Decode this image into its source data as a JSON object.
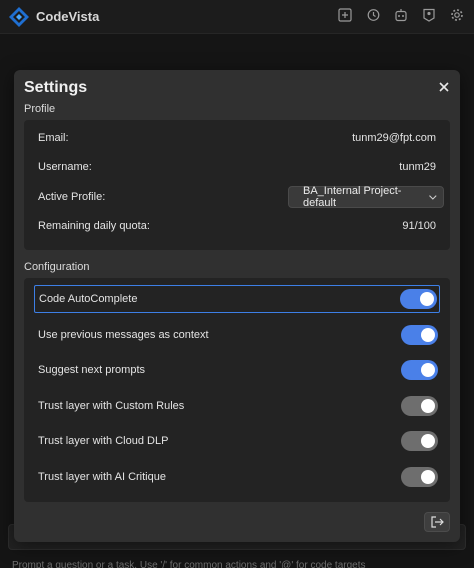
{
  "app": {
    "name": "CodeVista"
  },
  "topbar_icons": [
    "add-panel-icon",
    "history-icon",
    "agent-icon",
    "profile-badge-icon",
    "gear-icon"
  ],
  "modal": {
    "title": "Settings",
    "profile": {
      "section_label": "Profile",
      "email_label": "Email:",
      "email_value": "tunm29@fpt.com",
      "username_label": "Username:",
      "username_value": "tunm29",
      "active_profile_label": "Active Profile:",
      "active_profile_value": "BA_Internal Project-default",
      "quota_label": "Remaining daily quota:",
      "quota_value": "91/100"
    },
    "configuration": {
      "section_label": "Configuration",
      "items": [
        {
          "label": "Code AutoComplete",
          "enabled": true
        },
        {
          "label": "Use previous messages as context",
          "enabled": true
        },
        {
          "label": "Suggest next prompts",
          "enabled": true
        },
        {
          "label": "Trust layer with Custom Rules",
          "enabled": false
        },
        {
          "label": "Trust layer with Cloud DLP",
          "enabled": false
        },
        {
          "label": "Trust layer with AI Critique",
          "enabled": false
        }
      ]
    }
  },
  "composer": {
    "hint": "Prompt a question or a task. Use '/' for common actions and '@' for code targets"
  },
  "colors": {
    "accent": "#4a80e8",
    "toggle_off": "#6e6e6e",
    "focus_border": "#3d7fe6"
  }
}
